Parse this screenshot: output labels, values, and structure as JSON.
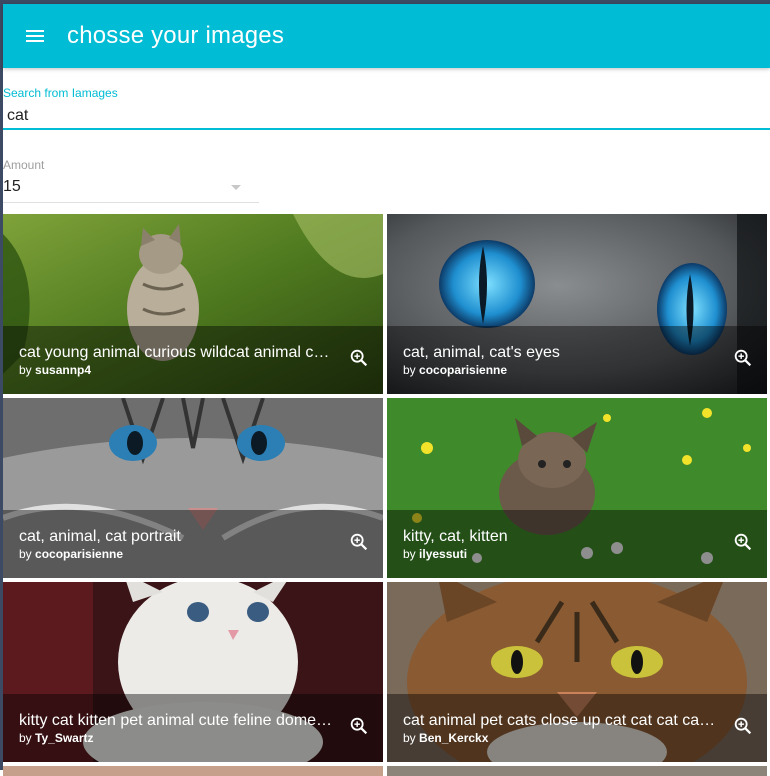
{
  "app": {
    "title": "chosse your images"
  },
  "search": {
    "label": "Search from Iamages",
    "value": "cat"
  },
  "amount": {
    "label": "Amount",
    "value": "15"
  },
  "results": [
    {
      "title": "cat young animal curious wildcat animal c…",
      "by": "by",
      "author": "susannp4",
      "icon": "zoom-in-icon"
    },
    {
      "title": "cat, animal, cat's eyes",
      "by": "by",
      "author": "cocoparisienne",
      "icon": "zoom-in-icon"
    },
    {
      "title": "cat, animal, cat portrait",
      "by": "by",
      "author": "cocoparisienne",
      "icon": "zoom-in-icon"
    },
    {
      "title": "kitty, cat, kitten",
      "by": "by",
      "author": "ilyessuti",
      "icon": "zoom-in-icon"
    },
    {
      "title": "kitty cat kitten pet animal cute feline dome…",
      "by": "by",
      "author": "Ty_Swartz",
      "icon": "zoom-in-icon"
    },
    {
      "title": "cat animal pet cats close up cat cat cat ca…",
      "by": "by",
      "author": "Ben_Kerckx",
      "icon": "zoom-in-icon"
    }
  ],
  "colors": {
    "primary": "#00bcd4",
    "overlay": "rgba(0,0,0,0.42)"
  }
}
